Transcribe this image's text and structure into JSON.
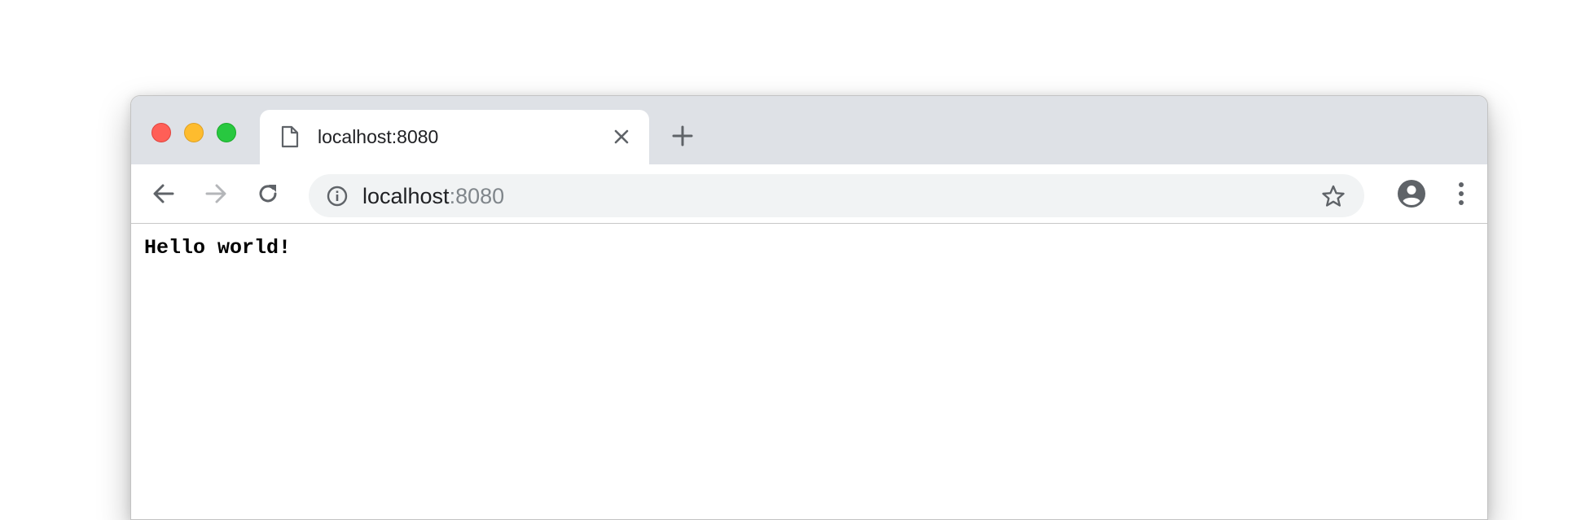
{
  "browser": {
    "tab": {
      "title": "localhost:8080",
      "icon": "document-icon"
    },
    "new_tab_icon": "plus-icon",
    "toolbar": {
      "back_icon": "arrow-left-icon",
      "forward_icon": "arrow-right-icon",
      "reload_icon": "reload-icon",
      "address": {
        "host": "localhost",
        "port": ":8080",
        "security_icon": "info-icon"
      },
      "bookmark_icon": "star-icon",
      "profile_icon": "account-circle-icon",
      "menu_icon": "vertical-dots-icon"
    }
  },
  "page": {
    "body_text": "Hello world!"
  },
  "colors": {
    "titlebar": "#dee1e6",
    "omnibox": "#f1f3f4",
    "close": "#ff5f57",
    "minimize": "#febc2e",
    "maximize": "#28c840"
  }
}
